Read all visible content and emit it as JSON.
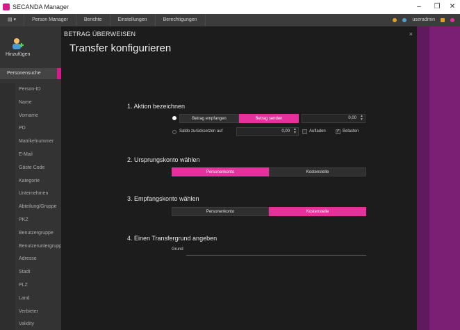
{
  "window": {
    "title": "SECANDA Manager",
    "controls": {
      "minimize": "–",
      "maximize": "❐",
      "close": "✕"
    }
  },
  "menu": {
    "items": [
      "Person Manager",
      "Berichte",
      "Einstellungen",
      "Berechtigungen"
    ],
    "user": "useradmin"
  },
  "toolbar": {
    "add_label": "Hinzufügen"
  },
  "left": {
    "search_tab": "Personensuche",
    "fields": [
      "Person-ID",
      "Name",
      "Vorname",
      "PD",
      "Matrikelnummer",
      "E-Mail",
      "Gäste Code",
      "Kategorie",
      "Unternehmen",
      "Abteilung/Gruppe",
      "PKZ",
      "Benutzergruppe",
      "Benutzeruntergruppe",
      "Adresse",
      "Stadt",
      "PLZ",
      "Land",
      "Verbieter",
      "Validity"
    ]
  },
  "dialog": {
    "header": "BETRAG ÜBERWEISEN",
    "title": "Transfer konfigurieren",
    "close": "×",
    "section1": {
      "title": "1. Aktion bezeichnen",
      "options": [
        "Betrag empfangen",
        "Betrag senden"
      ],
      "selected": "Betrag senden",
      "amount": "0,00",
      "reset_label": "Saldo zurücksetzen auf",
      "reset_amount": "0,00",
      "check_aufladen": "Aufladen",
      "check_belasten": "Belasten",
      "belasten_checked": "✓"
    },
    "section2": {
      "title": "2. Ursprungskonto wählen",
      "options": [
        "Personenkonto",
        "Kostenstelle"
      ],
      "selected": "Personenkonto"
    },
    "section3": {
      "title": "3. Empfangskonto wählen",
      "options": [
        "Personenkonto",
        "Kostenstelle"
      ],
      "selected": "Kostenstelle"
    },
    "section4": {
      "title": "4. Einen Transfergrund angeben",
      "reason_label": "Grund",
      "reason_value": ""
    }
  },
  "colors": {
    "accent": "#e6319c",
    "dialog_bg": "#1c1c1c",
    "side_bg": "#7a1f74"
  }
}
